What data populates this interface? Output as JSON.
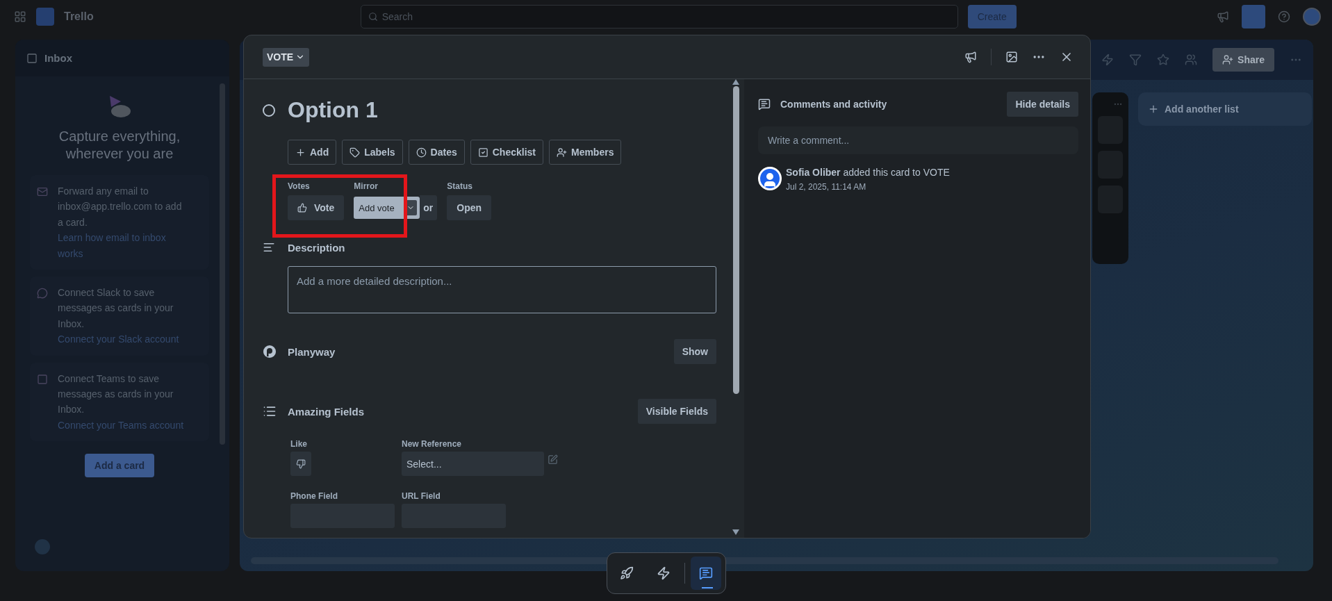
{
  "topbar": {
    "app_name": "Trello",
    "search": {
      "placeholder": "Search"
    },
    "create_button": "Create"
  },
  "inbox": {
    "title": "Inbox",
    "headline": "Capture everything, wherever you are",
    "items": [
      {
        "kind": "email",
        "text": "Forward any email to inbox@app.trello.com to add a card.",
        "link": "Learn how email to inbox works"
      },
      {
        "kind": "slack",
        "text": "Connect Slack to save messages as cards in your Inbox.",
        "link": "Connect your Slack account"
      },
      {
        "kind": "teams",
        "text": "Connect Teams to save messages as cards in your Inbox.",
        "link": "Connect your Teams account"
      }
    ],
    "add_card_button": "Add a card"
  },
  "board": {
    "share_button": "Share",
    "add_list_button": "Add another list"
  },
  "card": {
    "list_button": "VOTE",
    "title": "Option 1",
    "completed": false,
    "actions": [
      {
        "kind": "add",
        "label": "Add"
      },
      {
        "kind": "labels",
        "label": "Labels"
      },
      {
        "kind": "dates",
        "label": "Dates"
      },
      {
        "kind": "checklist",
        "label": "Checklist"
      },
      {
        "kind": "members",
        "label": "Members"
      }
    ],
    "badges": [
      {
        "kind": "vote",
        "label": "Votes",
        "value": "Vote"
      },
      {
        "kind": "mirror",
        "label": "Mirror",
        "value": "or",
        "popup": "Add vote"
      },
      {
        "kind": "status",
        "label": "Status",
        "value": "Open"
      }
    ],
    "description": {
      "title": "Description",
      "placeholder": "Add a more detailed description..."
    },
    "planyway": {
      "title": "Planyway",
      "button": "Show"
    },
    "amazing_fields": {
      "title": "Amazing Fields",
      "button": "Visible Fields",
      "fields": [
        {
          "kind": "like",
          "label": "Like"
        },
        {
          "kind": "select",
          "label": "New Reference",
          "placeholder": "Select..."
        },
        {
          "kind": "text",
          "label": "Phone Field"
        },
        {
          "kind": "text",
          "label": "URL Field"
        }
      ]
    }
  },
  "activity": {
    "title": "Comments and activity",
    "hide_button": "Hide details",
    "comment": {
      "placeholder": "Write a comment..."
    },
    "entries": [
      {
        "user": "Sofia Oliber",
        "action": "added this card to VOTE",
        "time": "Jul 2, 2025, 11:14 AM"
      }
    ]
  },
  "dock": [
    {
      "kind": "rocket",
      "selected": false
    },
    {
      "kind": "bolt",
      "selected": false
    },
    {
      "kind": "chat",
      "selected": true
    }
  ]
}
